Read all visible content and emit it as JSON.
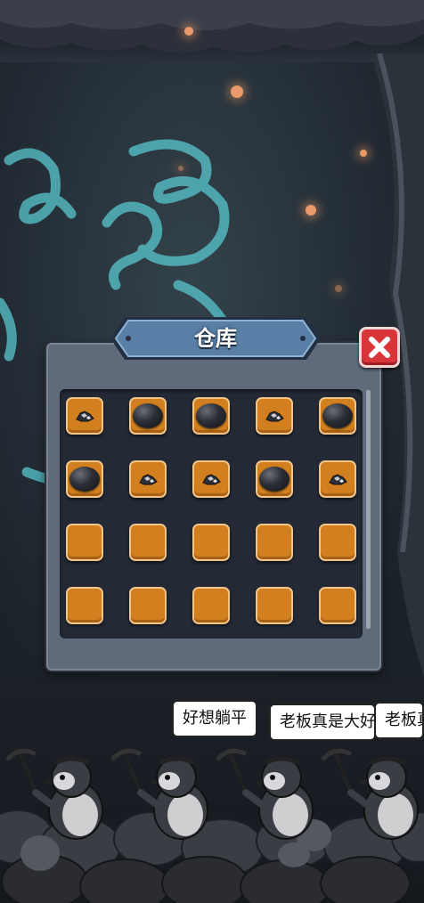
{
  "scene": {
    "name": "mine-cave",
    "colors": {
      "wall": "#263039",
      "rune_glow": "#59c7cf",
      "ember": "#e89a6a"
    }
  },
  "warehouse": {
    "title": "仓库",
    "close_icon": "close-x-icon",
    "colors": {
      "panel": "#5f6b7b",
      "slot": "#d2801f",
      "slot_border": "#f2c58a",
      "close": "#d8363a"
    },
    "slots": [
      {
        "item": "ore"
      },
      {
        "item": "coal"
      },
      {
        "item": "coal"
      },
      {
        "item": "ore"
      },
      {
        "item": "coal"
      },
      {
        "item": "coal"
      },
      {
        "item": "ore"
      },
      {
        "item": "ore"
      },
      {
        "item": "coal"
      },
      {
        "item": "ore"
      },
      {
        "item": "empty"
      },
      {
        "item": "empty"
      },
      {
        "item": "empty"
      },
      {
        "item": "empty"
      },
      {
        "item": "empty"
      },
      {
        "item": "empty"
      },
      {
        "item": "empty"
      },
      {
        "item": "empty"
      },
      {
        "item": "empty"
      },
      {
        "item": "empty"
      }
    ]
  },
  "workers": {
    "bubbles": [
      {
        "text": "好想躺平"
      },
      {
        "text": "老板真是大好人"
      },
      {
        "text": "老板真是大好人"
      }
    ]
  }
}
